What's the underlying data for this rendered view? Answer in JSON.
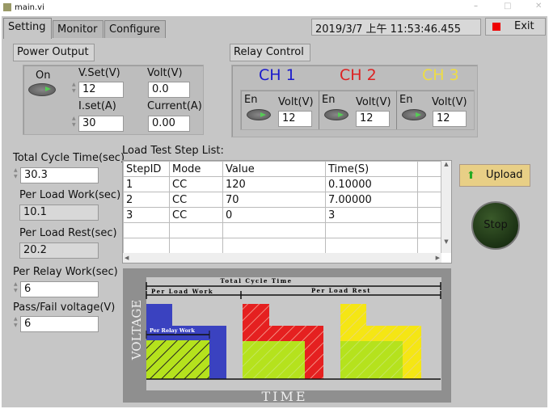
{
  "window": {
    "title": "main.vi"
  },
  "tabs": [
    "Setting",
    "Monitor",
    "Configure"
  ],
  "datetime": "2019/3/7  上午 11:53:46.455",
  "exit_label": "Exit",
  "power": {
    "title": "Power Output",
    "on_label": "On",
    "vset_label": "V.Set(V)",
    "vset": "12",
    "iset_label": "I.set(A)",
    "iset": "30",
    "volt_label": "Volt(V)",
    "volt": "0.0",
    "current_label": "Current(A)",
    "current": "0.00"
  },
  "relay": {
    "title": "Relay Control",
    "channels": [
      {
        "name": "CH 1",
        "color": "#1a1acc",
        "en": "En",
        "volt_label": "Volt(V)",
        "volt": "12"
      },
      {
        "name": "CH 2",
        "color": "#dd2222",
        "en": "En",
        "volt_label": "Volt(V)",
        "volt": "12"
      },
      {
        "name": "CH 3",
        "color": "#eedd44",
        "en": "En",
        "volt_label": "Volt(V)",
        "volt": "12"
      }
    ]
  },
  "params": {
    "total_label": "Total Cycle Time(sec)",
    "total": "30.3",
    "work_label": "Per Load Work(sec)",
    "work": "10.1",
    "rest_label": "Per Load Rest(sec)",
    "rest": "20.2",
    "relay_label": "Per Relay Work(sec)",
    "relay": "6",
    "pf_label": "Pass/Fail voltage(V)",
    "pf": "6"
  },
  "steps": {
    "title": "Load Test Step List:",
    "headers": [
      "StepID",
      "Mode",
      "Value",
      "Time(S)"
    ],
    "rows": [
      [
        "1",
        "CC",
        "120",
        "0.10000"
      ],
      [
        "2",
        "CC",
        "70",
        "7.00000"
      ],
      [
        "3",
        "CC",
        "0",
        "3"
      ]
    ]
  },
  "upload_label": "Upload",
  "stop_label": "Stop",
  "diagram": {
    "total": "Total  Cycle  Time",
    "work": "Per  Load  Work",
    "rest": "Per  Load  Rest",
    "relay": "Per Relay Work",
    "yaxis": "VOLTAGE",
    "xaxis": "TIME"
  }
}
